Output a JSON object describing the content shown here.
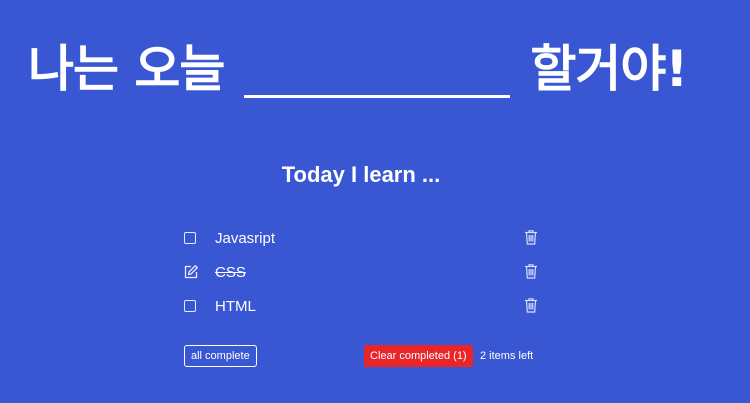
{
  "colors": {
    "background": "#3a57d3",
    "text": "#ffffff",
    "clear_button": "#e8262a"
  },
  "hero": {
    "prefix": "나는 오늘",
    "suffix": "할거야!"
  },
  "subtitle": "Today I learn ...",
  "todos": [
    {
      "label": "Javasript",
      "completed": false,
      "state_icon": "checkbox-icon",
      "delete_icon": "trash-icon"
    },
    {
      "label": "CSS",
      "completed": true,
      "state_icon": "edit-icon",
      "delete_icon": "trash-icon"
    },
    {
      "label": "HTML",
      "completed": false,
      "state_icon": "checkbox-icon",
      "delete_icon": "trash-icon"
    }
  ],
  "footer": {
    "all_complete_label": "all complete",
    "clear_completed_label": "Clear completed (1)",
    "items_left": "2 items left"
  }
}
